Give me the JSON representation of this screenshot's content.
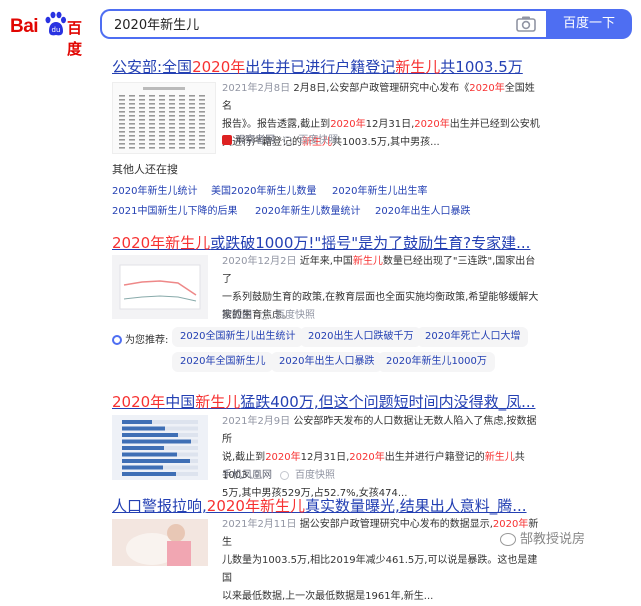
{
  "header": {
    "logo_text_left": "Bai",
    "logo_text_right": "百度",
    "query": "2020年新生儿",
    "search_button": "百度一下",
    "camera_icon": "camera-icon"
  },
  "results": [
    {
      "title_parts": [
        "公安部:全国",
        "2020年",
        "出生并已进行户籍登记",
        "新生儿",
        "共1003.5万"
      ],
      "date": "2021年2月8日",
      "snippet_lines": [
        "2月8日,公安部户政管理研究中心发布《2020年全国姓名",
        "报告》。报告透露,截止到2020年12月31日,2020年出生并已经到公安机",
        "关进行户籍登记的新生儿共1003.5万,其中男孩..."
      ],
      "source": "观察者网",
      "snapshot": "百度快照"
    },
    {
      "title_parts": [
        "2020年新生儿",
        "或跌破1000万!\"摇号\"是为了鼓励生育?专家建..."
      ],
      "date": "2020年12月2日",
      "snippet_lines": [
        "近年来,中国新生儿数量已经出现了\"三连跌\",国家出台了",
        "一系列鼓励生育的政策,在教育层面也全面实施均衡政策,希望能够缓解大",
        "家的生育焦虑。"
      ],
      "source": "搜狐网",
      "snapshot": "百度快照"
    },
    {
      "title_parts": [
        "2020年",
        "中国",
        "新生儿",
        "猛跌400万,但这个问题短时间内没得救_凤..."
      ],
      "date": "2021年2月9日",
      "snippet_lines": [
        "公安部昨天发布的人口数据让无数人陷入了焦虑,按数据所",
        "说,截止到2020年12月31日,2020年出生并进行户籍登记的新生儿共1003.",
        "5万,其中男孩529万,占52.7%,女孩474..."
      ],
      "source": "手机凤凰网",
      "snapshot": "百度快照"
    },
    {
      "title_parts": [
        "人口警报拉响,",
        "2020年新生儿",
        "真实数量曝光,结果出人意料_腾..."
      ],
      "date": "2021年2月11日",
      "snippet_lines": [
        "据公安部户政管理研究中心发布的数据显示,2020年新生",
        "儿数量为1003.5万,相比2019年减少461.5万,可以说是暴跌。这也是建国",
        "以来最低数据,上一次最低数据是1961年,新生..."
      ]
    }
  ],
  "related": {
    "title": "其他人还在搜",
    "links": [
      "2020年新生儿统计",
      "美国2020年新生儿数量",
      "2020年新生儿出生率",
      "2021中国新生儿下降的后果",
      "2020年新生儿数量统计",
      "2020年出生人口暴跌"
    ]
  },
  "recommend": {
    "label": "为您推荐:",
    "chips": [
      "2020全国新生儿出生统计",
      "2020出生人口跌破千万",
      "2020年死亡人口大增",
      "2020年全国新生儿",
      "2020年出生人口暴跌",
      "2020年新生儿1000万"
    ]
  },
  "watermark": "郜教授说房"
}
